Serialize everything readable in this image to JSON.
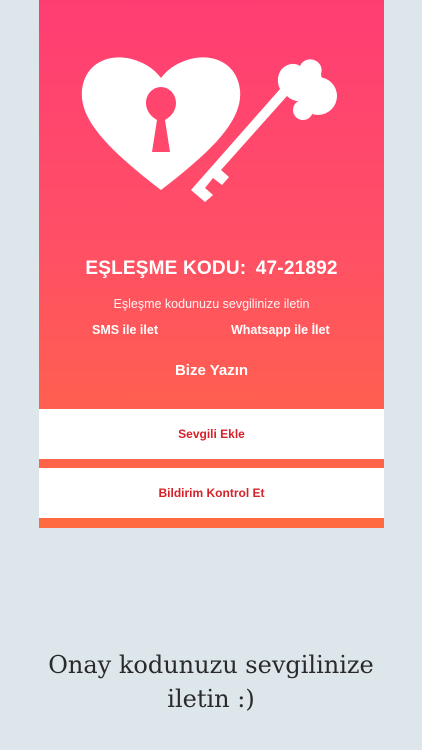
{
  "screen": {
    "code_label": "EŞLEŞME KODU:",
    "code_value": "47-21892",
    "subtitle": "Eşleşme kodunuzu sevgilinize iletin",
    "share_sms": "SMS ile ilet",
    "share_whatsapp": "Whatsapp ile İlet",
    "contact": "Bize Yazın",
    "add_partner": "Sevgili Ekle",
    "check_notifications": "Bildirim Kontrol Et"
  },
  "hero": {
    "icons": [
      "heart-lock-icon",
      "key-icon"
    ]
  },
  "caption": {
    "line1": "Onay kodunuzu sevgilinize",
    "line2": "iletin :)"
  },
  "colors": {
    "gradient_top": "#ff3d73",
    "gradient_bottom": "#ff6a40",
    "button_text": "#d62128",
    "background": "#dde6ea"
  }
}
